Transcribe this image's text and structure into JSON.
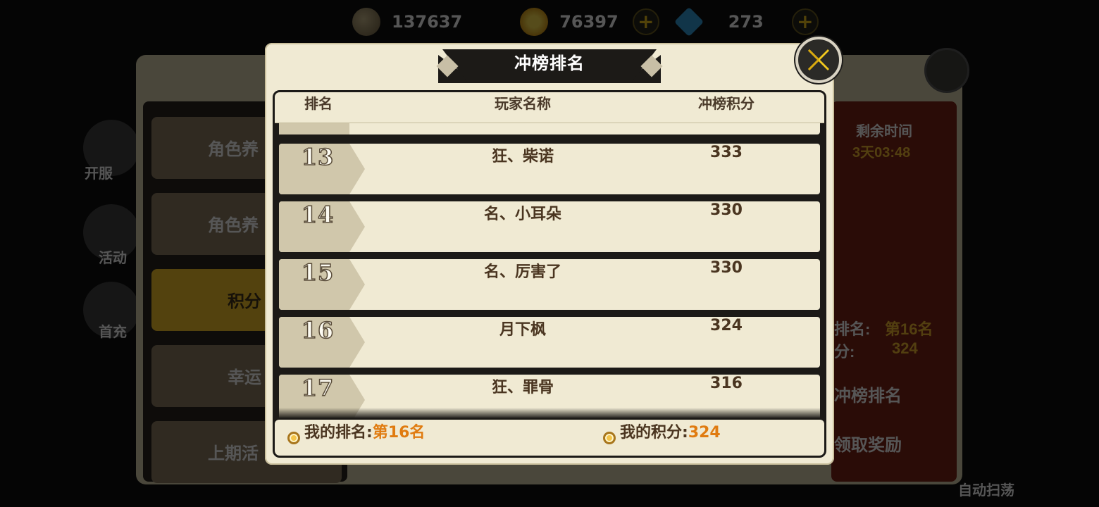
{
  "resources": [
    {
      "icon": "crossed-swords-icon",
      "value": "137637",
      "has_plus": false
    },
    {
      "icon": "gold-coin-icon",
      "value": "76397",
      "has_plus": true
    },
    {
      "icon": "blue-gem-icon",
      "value": "273",
      "has_plus": true
    }
  ],
  "background": {
    "menu_items": [
      "角色养",
      "角色养",
      "积分",
      "幸运",
      "上期活"
    ],
    "side_labels": [
      "开服",
      "活动",
      "首充"
    ],
    "right": {
      "time_title": "剩余时间",
      "time_value": "3天03:48",
      "rank_label": "排名:",
      "rank_value": "第16名",
      "score_label": "分:",
      "score_value": "324",
      "rank_button": "冲榜排名",
      "claim_button": "领取奖励",
      "auto_sweep": "自动扫荡"
    }
  },
  "dialog": {
    "title": "冲榜排名",
    "columns": {
      "rank": "排名",
      "player": "玩家名称",
      "score": "冲榜积分"
    },
    "rows": [
      {
        "rank": "13",
        "name": "狂、柴诺",
        "score": "333"
      },
      {
        "rank": "14",
        "name": "名、小耳朵",
        "score": "330"
      },
      {
        "rank": "15",
        "name": "名、厉害了",
        "score": "330"
      },
      {
        "rank": "16",
        "name": "月下枫",
        "score": "324"
      },
      {
        "rank": "17",
        "name": "狂、罪骨",
        "score": "316"
      }
    ],
    "footer": {
      "my_rank_label": "我的排名:",
      "my_rank_value": "第16名",
      "my_score_label": "我的积分:",
      "my_score_value": "324"
    }
  },
  "colors": {
    "panel": "#f0ead3",
    "rank_column": "#d0c7ab",
    "frame": "#1c1a17",
    "text": "#4a3520",
    "highlight": "#e07b10",
    "close_icon": "#f2c81e"
  }
}
